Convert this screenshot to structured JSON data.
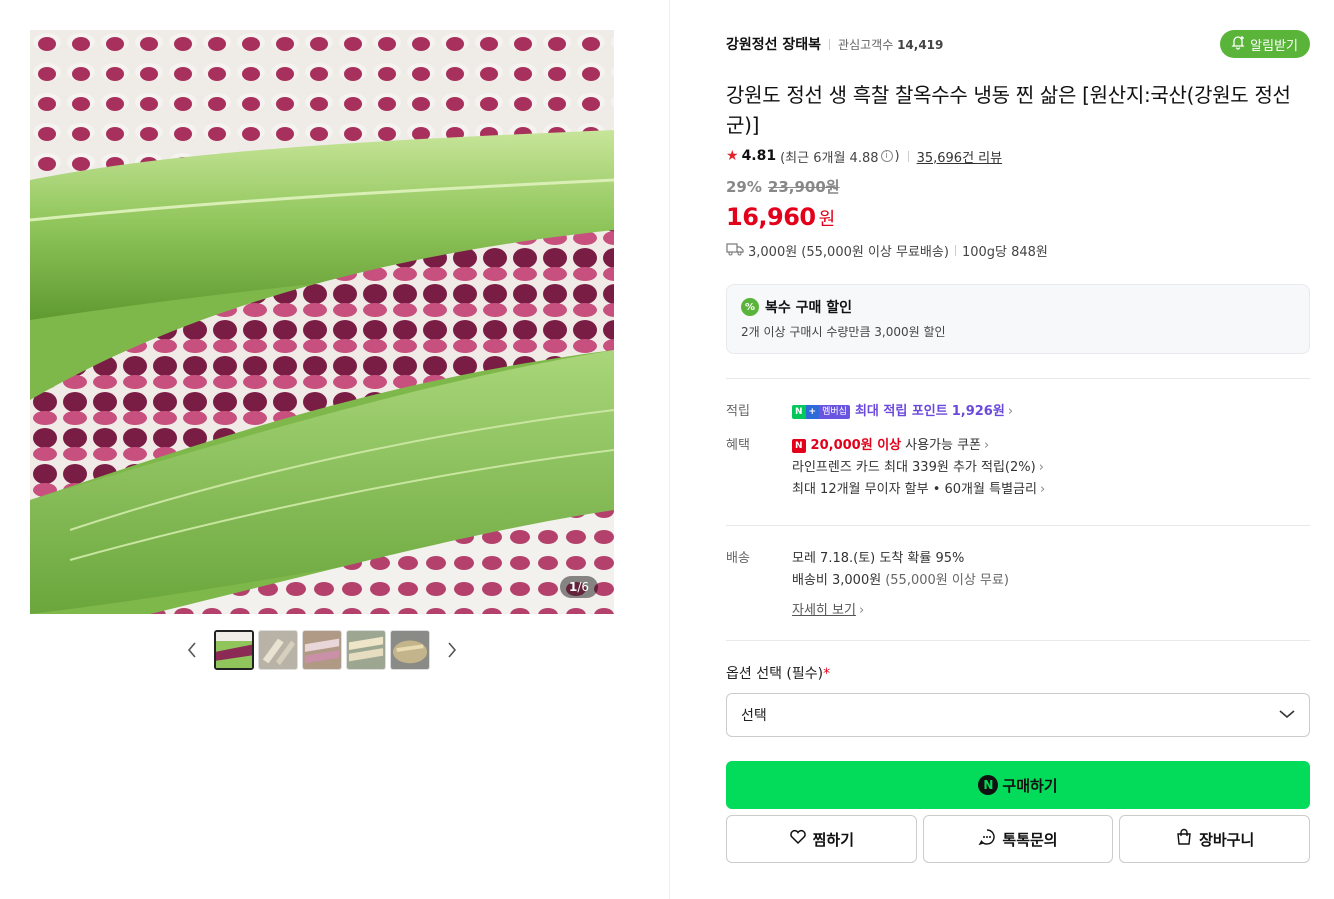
{
  "gallery": {
    "counter_current": "1",
    "counter_total": "/6",
    "thumb_count": 5
  },
  "store": {
    "name": "강원정선 장태복",
    "fans_label": "관심고객수",
    "fans_count": "14,419",
    "alarm_label": "알림받기"
  },
  "product": {
    "title": "강원도 정선 생 흑찰 찰옥수수 냉동 찐 삶은 [원산지:국산(강원도 정선군)]",
    "rating": "4.81",
    "recent_rating": "(최근 6개월 4.88",
    "recent_rating_close": ")",
    "review_count": "35,696건 리뷰",
    "discount_rate": "29%",
    "original_price": "23,900원",
    "price": "16,960",
    "currency": "원",
    "shipping": "3,000원 (55,000원 이상 무료배송)",
    "unit_price": "100g당 848원"
  },
  "promo": {
    "badge": "%",
    "title": "복수 구매 할인",
    "desc": "2개 이상 구매시 수량만큼 3,000원 할인"
  },
  "benefits": {
    "points_label": "적립",
    "points_badge_n": "N",
    "points_badge_plus": "+",
    "points_badge_member": "멤버십",
    "points_text": "최대 적립 포인트",
    "points_value": "1,926원",
    "benefit_label": "혜택",
    "coupon_badge": "N",
    "coupon_highlight": "20,000원 이상",
    "coupon_text": "사용가능 쿠폰",
    "card_text": "라인프렌즈 카드 최대 339원 추가 적립(2%)",
    "installment_text": "최대 12개월 무이자 할부 • 60개월 특별금리"
  },
  "delivery": {
    "label": "배송",
    "arrival": "모레 7.18.(토) 도착 확률 95%",
    "fee": "배송비 3,000원",
    "fee_note": "(55,000원 이상 무료)",
    "more": "자세히 보기"
  },
  "options": {
    "label": "옵션 선택 (필수)",
    "required_mark": "*",
    "select_value": "선택"
  },
  "actions": {
    "buy_icon": "N",
    "buy_label": "구매하기",
    "wish_label": "찜하기",
    "talk_label": "톡톡문의",
    "cart_label": "장바구니"
  },
  "colors": {
    "accent_green": "#03dc5a",
    "alarm_green": "#5ab43a",
    "price_red": "#e3001b",
    "points_purple": "#6a49dc"
  }
}
